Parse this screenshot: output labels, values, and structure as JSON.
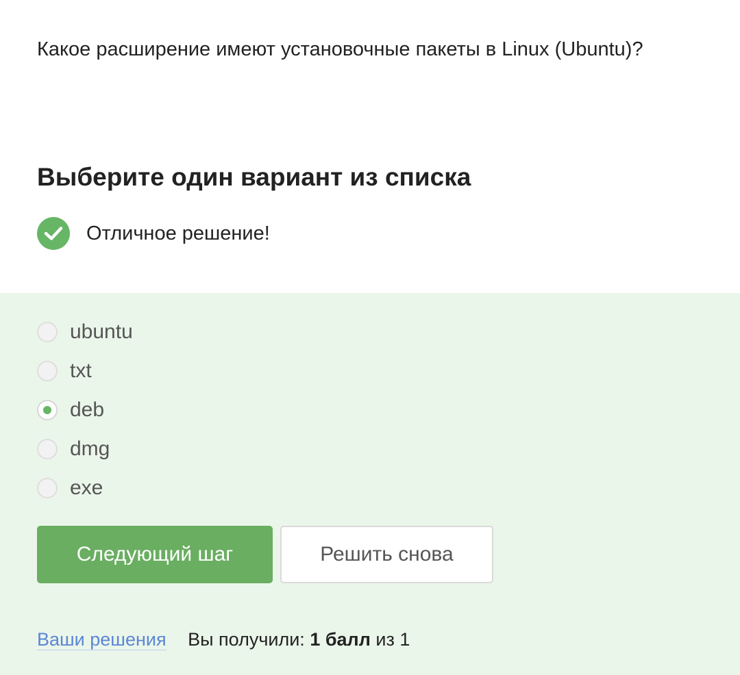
{
  "question": {
    "text": "Какое расширение имеют установочные пакеты в Linux (Ubuntu)?"
  },
  "section_title": "Выберите один вариант из списка",
  "feedback": {
    "icon": "check-circle-icon",
    "text": "Отличное решение!"
  },
  "options": [
    {
      "label": "ubuntu",
      "selected": false
    },
    {
      "label": "txt",
      "selected": false
    },
    {
      "label": "deb",
      "selected": true
    },
    {
      "label": "dmg",
      "selected": false
    },
    {
      "label": "exe",
      "selected": false
    }
  ],
  "buttons": {
    "next_label": "Следующий шаг",
    "retry_label": "Решить снова"
  },
  "footer": {
    "solutions_link": "Ваши решения",
    "score_prefix": "Вы получили:",
    "score_value": "1 балл",
    "score_suffix": "из 1"
  },
  "colors": {
    "success_green": "#66b666",
    "primary_button": "#6aae61",
    "answer_panel_bg": "#ebf6ea",
    "link": "#5b86d6"
  }
}
